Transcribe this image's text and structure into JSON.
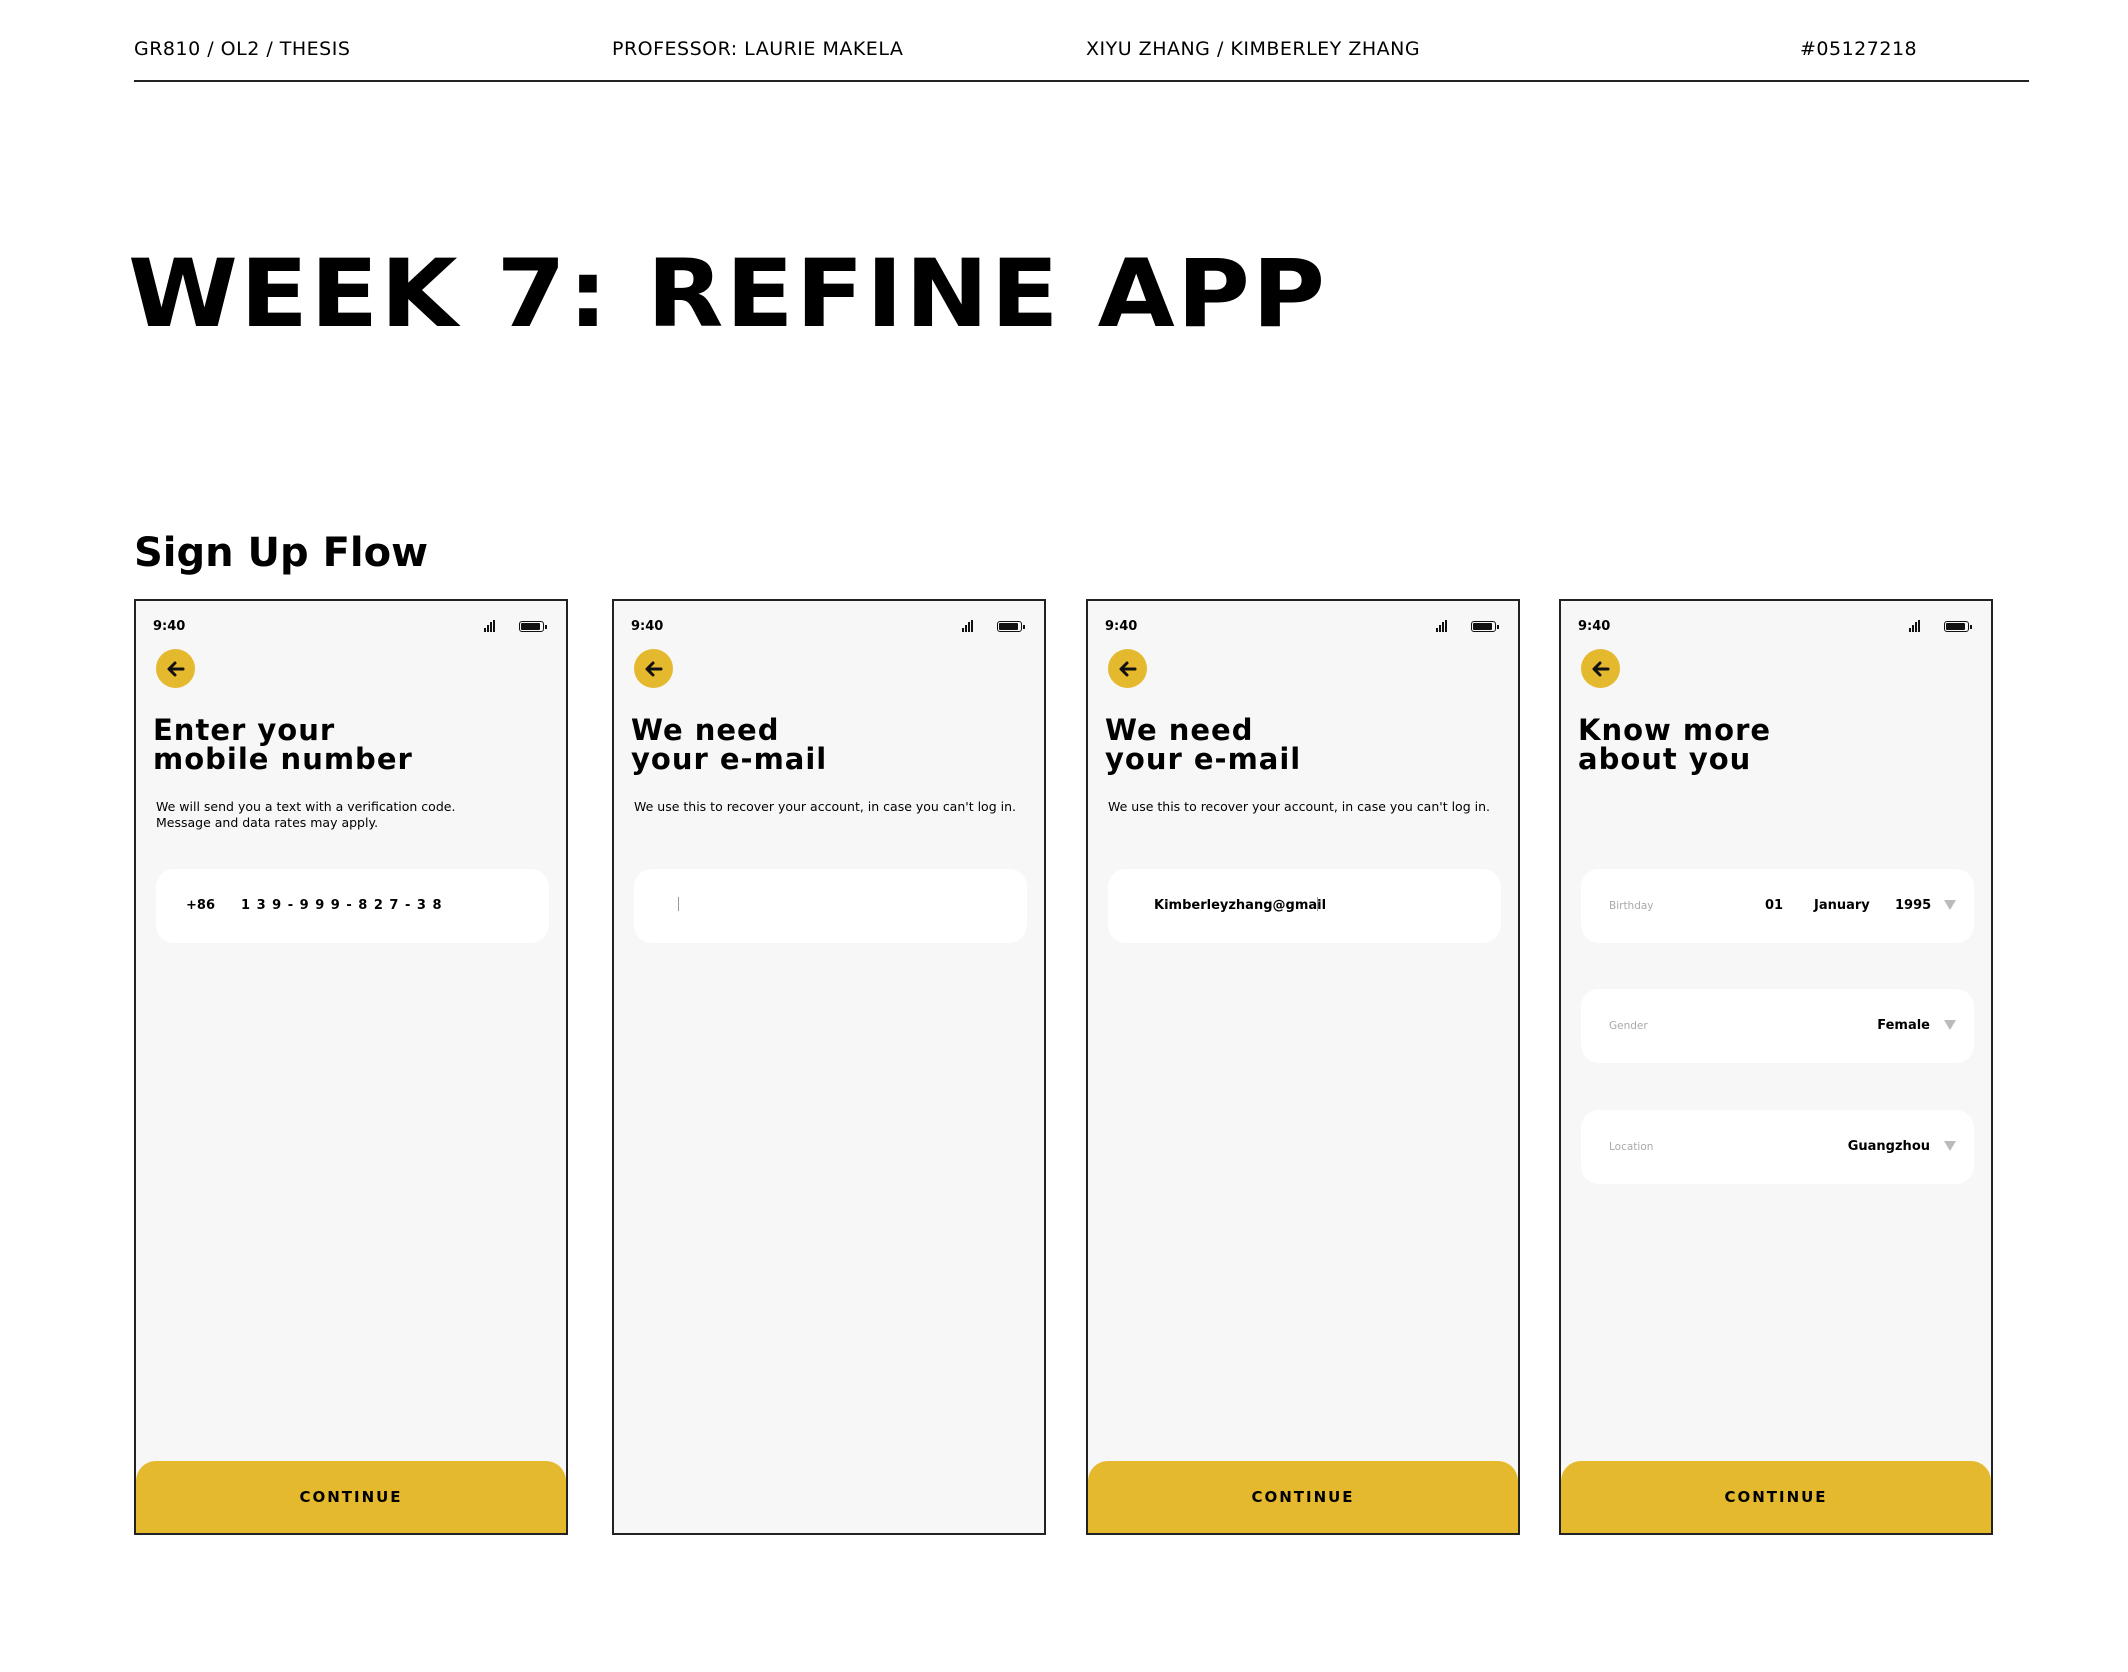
{
  "header": {
    "course": "GR810 / OL2 / THESIS",
    "professor": "PROFESSOR: LAURIE MAKELA",
    "authors": "XIYU ZHANG / KIMBERLEY ZHANG",
    "id": "#05127218"
  },
  "page": {
    "title": "WEEK 7: REFINE APP",
    "section": "Sign Up Flow"
  },
  "screens": [
    {
      "time": "9:40",
      "heading": "Enter your\nmobile number",
      "description": "We will send you a text with a verification code.\nMessage and data rates may apply.",
      "country_code": "+86",
      "phone_number": "1 3 9 - 9 9 9 - 8 2 7 - 3 8",
      "cta": "CONTINUE"
    },
    {
      "time": "9:40",
      "heading": "We need\nyour e-mail",
      "description": "We use this to recover your account, in case you can't log in.",
      "email_value": ""
    },
    {
      "time": "9:40",
      "heading": "We need\nyour e-mail",
      "description": "We use this to recover your account, in case you can't log in.",
      "email_value": "Kimberleyzhang@gmail",
      "cta": "CONTINUE"
    },
    {
      "time": "9:40",
      "heading": "Know more\nabout you",
      "birthday": {
        "label": "Birthday",
        "day": "01",
        "month": "January",
        "year": "1995"
      },
      "gender": {
        "label": "Gender",
        "value": "Female"
      },
      "location": {
        "label": "Location",
        "value": "Guangzhou"
      },
      "cta": "CONTINUE"
    }
  ],
  "icons": {
    "back": "arrow-left-icon",
    "signal": "signal-icon",
    "battery": "battery-icon",
    "dropdown": "triangle-down-icon"
  },
  "colors": {
    "accent": "#e5b92e",
    "screen_bg": "#f7f7f7"
  }
}
